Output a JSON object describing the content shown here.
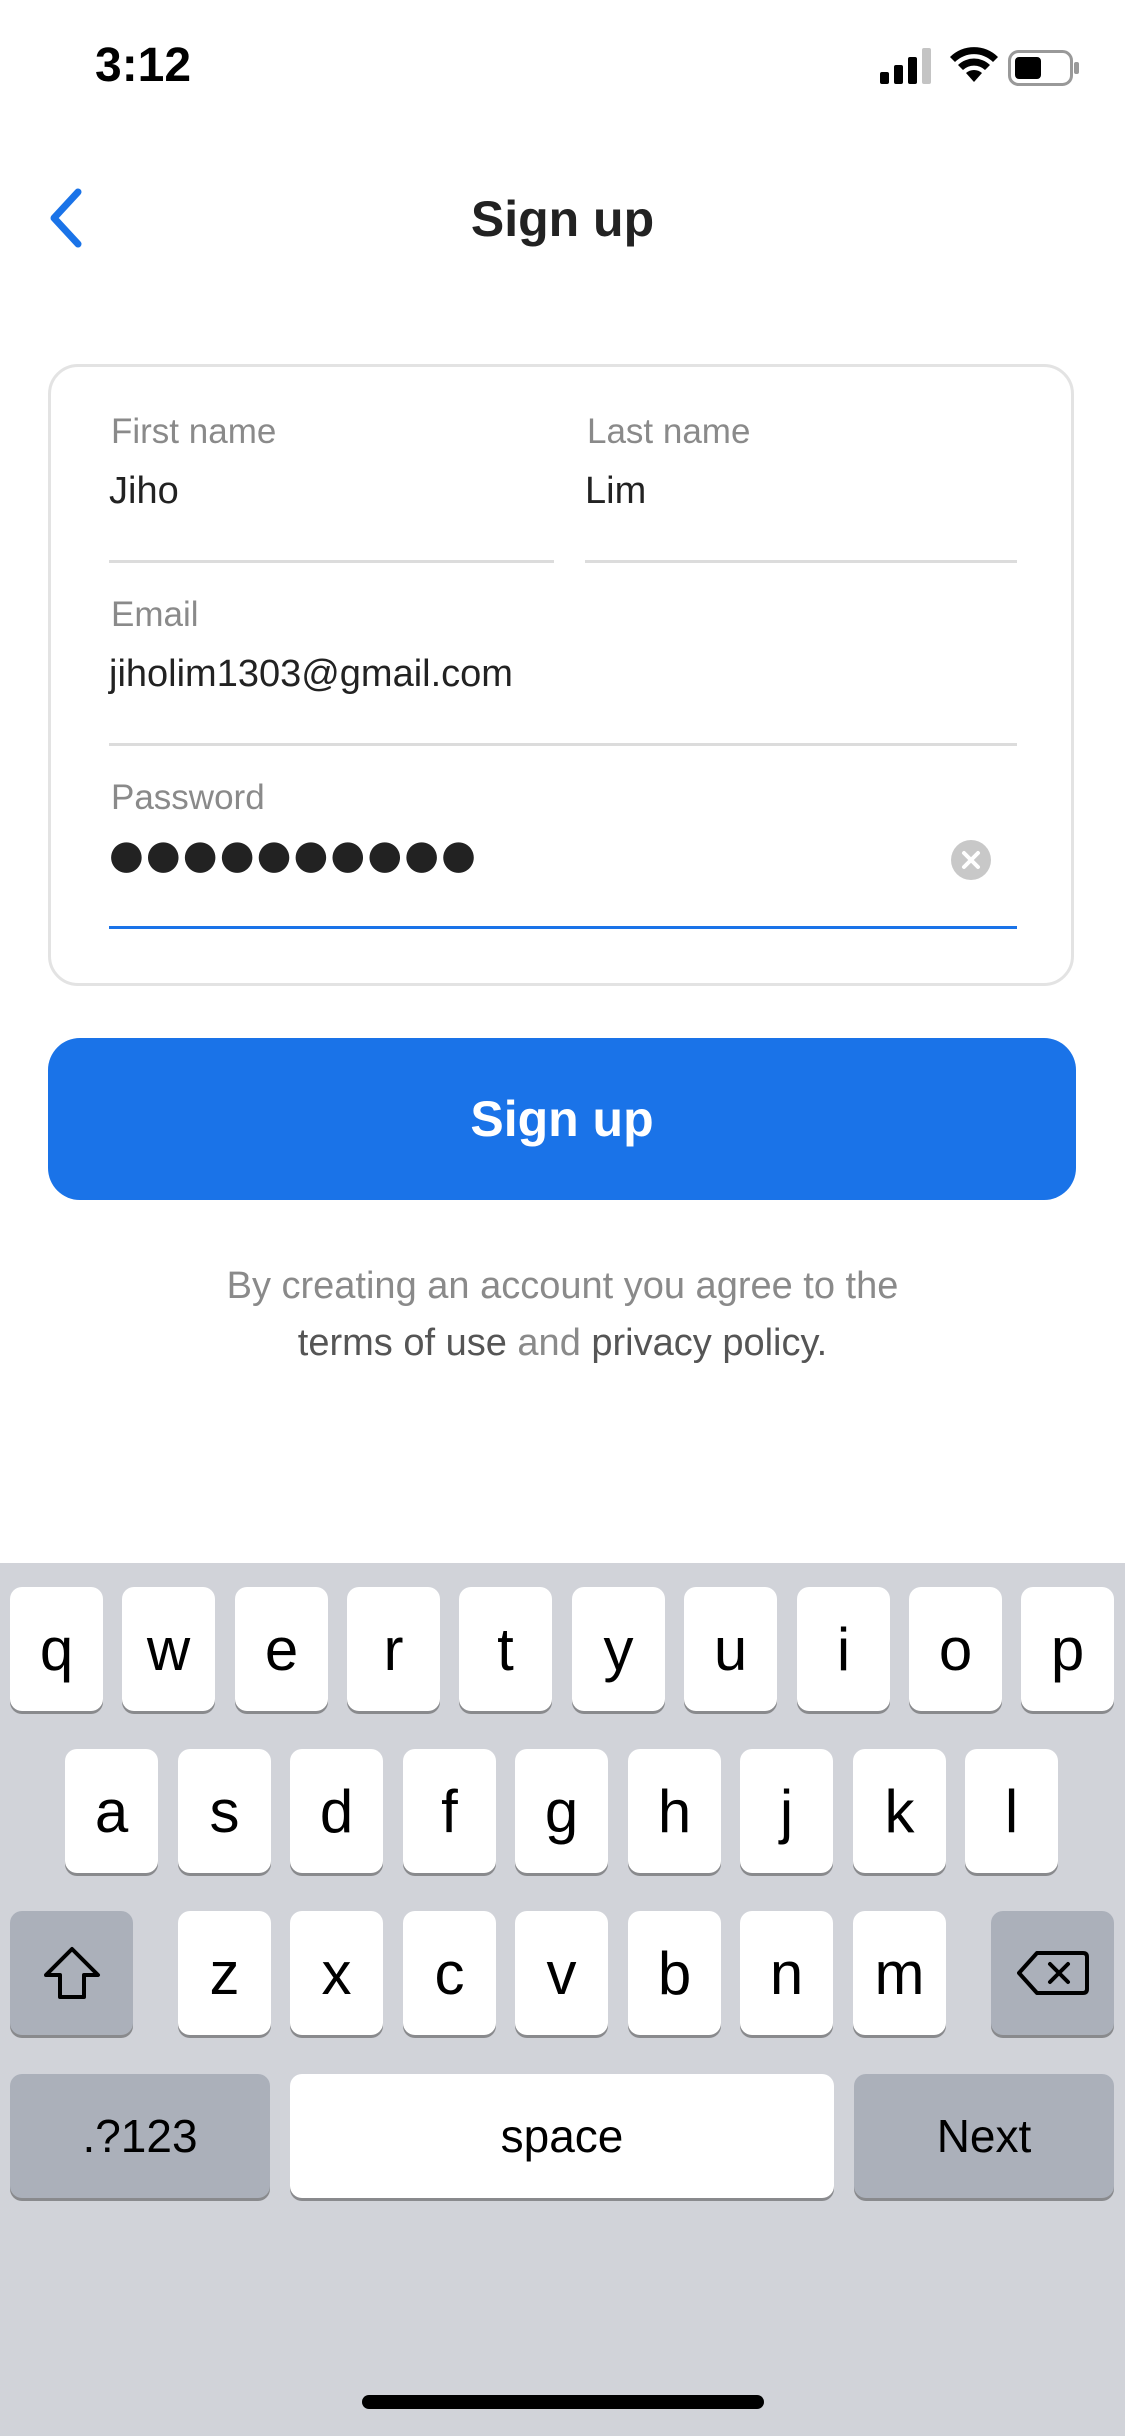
{
  "status_bar": {
    "time": "3:12"
  },
  "header": {
    "title": "Sign up"
  },
  "form": {
    "first_name": {
      "label": "First name",
      "value": "Jiho"
    },
    "last_name": {
      "label": "Last name",
      "value": "Lim"
    },
    "email": {
      "label": "Email",
      "value": "jiholim1303@gmail.com"
    },
    "password": {
      "label": "Password",
      "masked_value": "●●●●●●●●●●"
    }
  },
  "signup_button": {
    "label": "Sign up"
  },
  "terms": {
    "line1": "By creating an account you agree to the",
    "terms_link": "terms of use",
    "and": "and",
    "privacy_link": "privacy policy",
    "period": "."
  },
  "keyboard": {
    "row1": [
      "q",
      "w",
      "e",
      "r",
      "t",
      "y",
      "u",
      "i",
      "o",
      "p"
    ],
    "row2": [
      "a",
      "s",
      "d",
      "f",
      "g",
      "h",
      "j",
      "k",
      "l"
    ],
    "row3": [
      "z",
      "x",
      "c",
      "v",
      "b",
      "n",
      "m"
    ],
    "numbers_key": ".?123",
    "space_key": "space",
    "next_key": "Next",
    "shift_icon": "shift-icon",
    "backspace_icon": "backspace-icon"
  },
  "colors": {
    "accent": "#1a73e8",
    "keyboard_bg": "#d1d3d9",
    "key_dark": "#abb0ba"
  }
}
